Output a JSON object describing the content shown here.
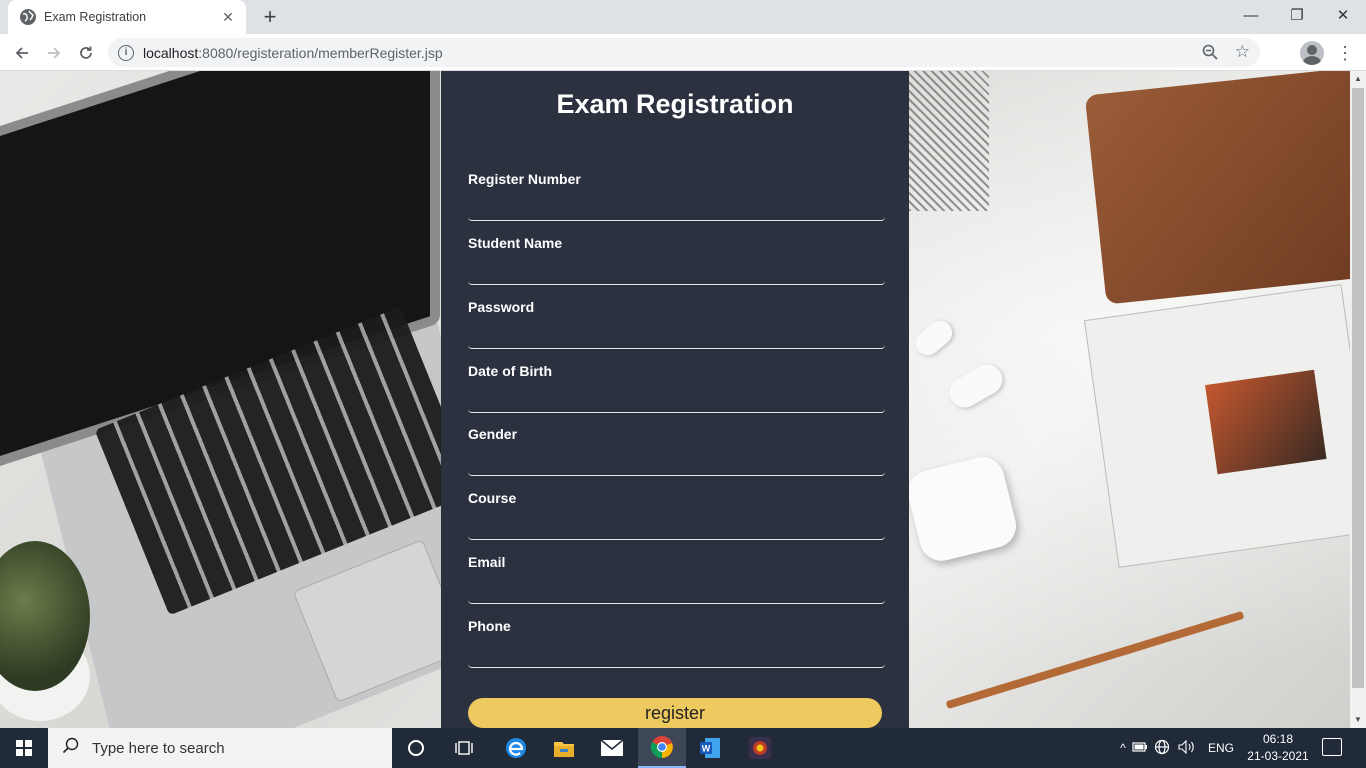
{
  "browser": {
    "tab_title": "Exam Registration",
    "tab_close": "✕",
    "new_tab": "+",
    "url_host": "localhost",
    "url_rest": ":8080/registeration/memberRegister.jsp",
    "window_controls": {
      "minimize": "—",
      "restore": "❐",
      "close": "✕"
    }
  },
  "page": {
    "heading": "Exam Registration",
    "fields": [
      {
        "label": "Register Number",
        "value": ""
      },
      {
        "label": "Student Name",
        "value": ""
      },
      {
        "label": "Password",
        "value": ""
      },
      {
        "label": "Date of Birth",
        "value": ""
      },
      {
        "label": "Gender",
        "value": ""
      },
      {
        "label": "Course",
        "value": ""
      },
      {
        "label": "Email",
        "value": ""
      },
      {
        "label": "Phone",
        "value": ""
      }
    ],
    "register_label": "register",
    "colors": {
      "panel": "#2c3140",
      "button": "#eec95f"
    }
  },
  "taskbar": {
    "search_placeholder": "Type here to search",
    "language": "ENG",
    "time": "06:18",
    "date": "21-03-2021",
    "pinned_apps": [
      "task-view-icon",
      "edge-icon",
      "file-explorer-icon",
      "mail-icon",
      "chrome-icon",
      "word-icon",
      "app-icon"
    ]
  }
}
